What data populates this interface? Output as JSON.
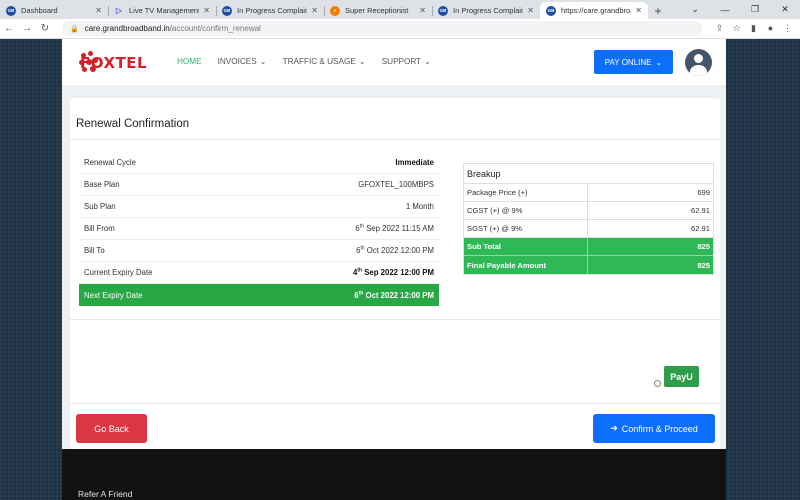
{
  "browser": {
    "tabs": [
      {
        "title": "Dashboard",
        "favicon": "ge-logo-icon"
      },
      {
        "title": "Live TV Management-C",
        "favicon": "tv-icon"
      },
      {
        "title": "In Progress Complaints",
        "favicon": "ge-logo-icon"
      },
      {
        "title": "Super Receptionist",
        "favicon": "sr-icon"
      },
      {
        "title": "In Progress Complaints",
        "favicon": "ge-logo-icon"
      },
      {
        "title": "https://care.grandbroadb",
        "favicon": "ge-logo-icon"
      }
    ],
    "favicon_text": "GB",
    "url_host": "care.grandbroadband.in",
    "url_path": "/account/confirm_renewal"
  },
  "navbar": {
    "logo_text": "FOXTEL",
    "menu": [
      "HOME",
      "INVOICES",
      "TRAFFIC & USAGE",
      "SUPPORT"
    ],
    "pay_online": "PAY ONLINE"
  },
  "renewal": {
    "title": "Renewal Confirmation",
    "rows": {
      "cycle": {
        "label": "Renewal Cycle",
        "value": "Immediate"
      },
      "base_plan": {
        "label": "Base Plan",
        "value": "GFOXTEL_100MBPS"
      },
      "sub_plan": {
        "label": "Sub Plan",
        "value": "1 Month"
      },
      "bill_from": {
        "label": "Bill From",
        "day": "6",
        "sup": "th",
        "rest": " Sep 2022 11:15 AM"
      },
      "bill_to": {
        "label": "Bill To",
        "day": "6",
        "sup": "th",
        "rest": " Oct 2022 12:00 PM"
      },
      "current_expiry": {
        "label": "Current Expiry Date",
        "day": "4",
        "sup": "th",
        "rest": " Sep 2022 12:00 PM"
      },
      "next_expiry": {
        "label": "Next Expiry Date",
        "day": "6",
        "sup": "th",
        "rest": " Oct 2022 12:00 PM"
      }
    }
  },
  "breakup": {
    "title": "Breakup",
    "rows": [
      {
        "label": "Package Price (+)",
        "value": "699"
      },
      {
        "label": "CGST (+) @ 9%",
        "value": "62.91"
      },
      {
        "label": "SGST (+) @ 9%",
        "value": "62.91"
      }
    ],
    "subtotal": {
      "label": "Sub Total",
      "value": "825"
    },
    "final": {
      "label": "Final Payable Amount",
      "value": "825"
    }
  },
  "payment": {
    "payu_label": "PayU"
  },
  "actions": {
    "go_back": "Go Back",
    "confirm": "Confirm & Proceed"
  },
  "footer": {
    "link": "Refer A Friend"
  },
  "colors": {
    "green": "#28a745",
    "blue": "#0d6efd",
    "red": "#dc3545",
    "brand": "#d62027"
  }
}
